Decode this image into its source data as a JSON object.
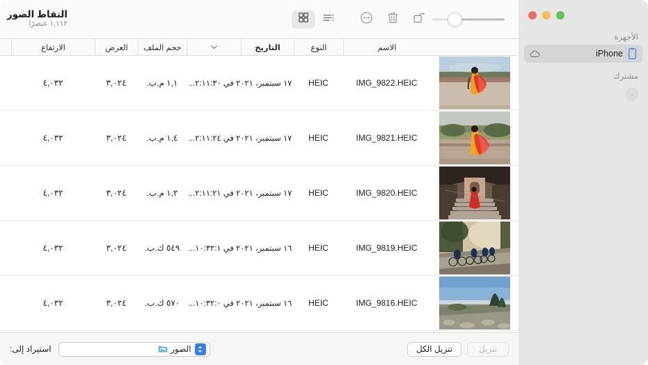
{
  "window": {
    "traffic_lights": [
      "green",
      "yellow",
      "red"
    ],
    "colors": {
      "accent": "#347fe8",
      "sidebar_bg": "#e6e6e6",
      "selected_row": "#d5d5d5",
      "close": "#ed6a5e",
      "minimize": "#f6bd50",
      "zoom": "#62c554"
    }
  },
  "header": {
    "title": "التقاط الصور",
    "subtitle": "١,١١٢ عنصرًا"
  },
  "toolbar": {
    "zoom_slider": {
      "icon": "zoom-slider",
      "value": 22
    },
    "buttons": [
      {
        "name": "rotate-button",
        "icon": "rotate-icon"
      },
      {
        "name": "delete-button",
        "icon": "trash-icon"
      },
      {
        "name": "more-button",
        "icon": "ellipsis-circle-icon"
      }
    ],
    "view_modes": [
      {
        "name": "list-view-button",
        "icon": "list-view-icon",
        "selected": false
      },
      {
        "name": "grid-view-button",
        "icon": "grid-view-icon",
        "selected": true
      }
    ]
  },
  "sidebar": {
    "sections": [
      {
        "header": "الأجهزة",
        "items": [
          {
            "label": "iPhone",
            "icon": "iphone-icon",
            "trailing_icon": "icloud-eject-icon",
            "selected": true
          }
        ]
      },
      {
        "header": "مشترك",
        "items": []
      }
    ]
  },
  "columns": [
    {
      "key": "thumb",
      "label": "",
      "sorted": false
    },
    {
      "key": "name",
      "label": "الاسم",
      "sorted": false
    },
    {
      "key": "type",
      "label": "النوع",
      "sorted": false
    },
    {
      "key": "date",
      "label": "التاريخ",
      "sorted": true
    },
    {
      "key": "chev",
      "label": "",
      "sorted": false
    },
    {
      "key": "size",
      "label": "حجم الملف",
      "sorted": false
    },
    {
      "key": "width",
      "label": "العرض",
      "sorted": false
    },
    {
      "key": "height",
      "label": "الارتفاع",
      "sorted": false
    }
  ],
  "rows": [
    {
      "name": "IMG_9822.HEIC",
      "type": "HEIC",
      "date": "١٧ سبتمبر، ٢٠٢١ في ٢:١١:٣٠...",
      "size": "١,١ م.ب.",
      "width": "٣,٠٢٤",
      "height": "٤,٠٣٢",
      "thumbnail": "woman-red-sari-terrace"
    },
    {
      "name": "IMG_9821.HEIC",
      "type": "HEIC",
      "date": "١٧ سبتمبر، ٢٠٢١ في ٢:١١:٢٤...",
      "size": "١,٤ م.ب.",
      "width": "٣,٠٢٤",
      "height": "٤,٠٣٢",
      "thumbnail": "woman-red-sari-garden"
    },
    {
      "name": "IMG_9820.HEIC",
      "type": "HEIC",
      "date": "١٧ سبتمبر، ٢٠٢١ في ٢:١١:٢١...",
      "size": "١,٢ م.ب.",
      "width": "٣,٠٢٤",
      "height": "٤,٠٣٢",
      "thumbnail": "woman-red-dress-stairs"
    },
    {
      "name": "IMG_9819.HEIC",
      "type": "HEIC",
      "date": "١٦ سبتمبر، ٢٠٢١ في ١٠:٣٢:١...",
      "size": "٥٤٩ ك.ب.",
      "width": "٣,٠٢٤",
      "height": "٤,٠٣٢",
      "thumbnail": "cyclists-on-road"
    },
    {
      "name": "IMG_9816.HEIC",
      "type": "HEIC",
      "date": "١٦ سبتمبر، ٢٠٢١ في ١٠:٣٢:٠...",
      "size": "٥٧٠ ك.ب.",
      "width": "٣,٠٢٤",
      "height": "٤,٠٣٢",
      "thumbnail": "mountain-ridge-vista"
    }
  ],
  "bottom_bar": {
    "import_label": "استيراد إلى:",
    "import_destination": "الصور",
    "import_destination_icon": "photos-folder-icon",
    "download_button": {
      "label": "تنزيل",
      "enabled": false
    },
    "download_all_button": {
      "label": "تنزيل الكل",
      "enabled": true
    }
  }
}
